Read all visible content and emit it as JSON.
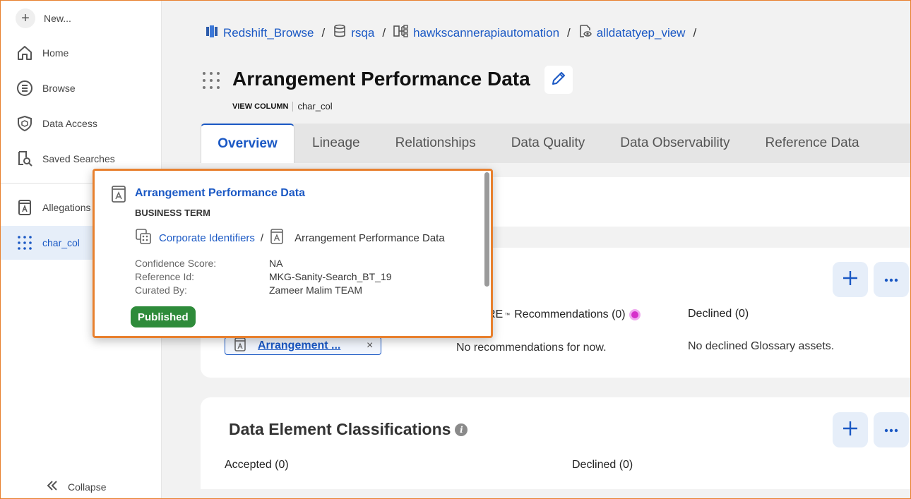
{
  "sidebar": {
    "new_label": "New...",
    "items": [
      {
        "label": "Home",
        "icon": "home-icon"
      },
      {
        "label": "Browse",
        "icon": "browse-icon"
      },
      {
        "label": "Data Access",
        "icon": "shield-icon"
      },
      {
        "label": "Saved Searches",
        "icon": "saved-search-icon"
      }
    ],
    "recent": [
      {
        "label": "Allegations",
        "icon": "business-term-icon"
      },
      {
        "label": "char_col",
        "icon": "column-dots-icon",
        "active": true
      }
    ],
    "collapse_label": "Collapse"
  },
  "breadcrumb": [
    {
      "label": "Redshift_Browse",
      "icon": "redshift-icon"
    },
    {
      "label": "rsqa",
      "icon": "database-icon"
    },
    {
      "label": "hawkscannerapiautomation",
      "icon": "schema-icon"
    },
    {
      "label": "alldatatyep_view",
      "icon": "view-icon"
    }
  ],
  "header": {
    "title": "Arrangement Performance Data",
    "kind": "VIEW COLUMN",
    "name": "char_col"
  },
  "tabs": [
    "Overview",
    "Lineage",
    "Relationships",
    "Data Quality",
    "Data Observability",
    "Reference Data"
  ],
  "glossary": {
    "recommendations_prefix": "RE",
    "recommendations_tm": "™",
    "recommendations_label": "Recommendations (0)",
    "declined_label": "Declined (0)",
    "no_recommendations": "No recommendations for now.",
    "no_declined": "No declined Glossary assets.",
    "chip_label": "Arrangement ...",
    "chip_close": "×"
  },
  "classifications": {
    "title": "Data Element Classifications",
    "info_glyph": "i",
    "accepted_label": "Accepted (0)",
    "declined_label": "Declined (0)"
  },
  "popover": {
    "title": "Arrangement Performance Data",
    "type": "BUSINESS TERM",
    "path_parent": "Corporate Identifiers",
    "path_separator": "/",
    "path_current": "Arrangement Performance Data",
    "meta_labels": [
      "Confidence Score:",
      "Reference Id:",
      "Curated By:"
    ],
    "meta_values": [
      "NA",
      "MKG-Sanity-Search_BT_19",
      "Zameer Malim TEAM"
    ],
    "status": "Published"
  },
  "colors": {
    "accent": "#1a58c4",
    "highlight_border": "#e8802e",
    "published": "#2e8b3a"
  }
}
